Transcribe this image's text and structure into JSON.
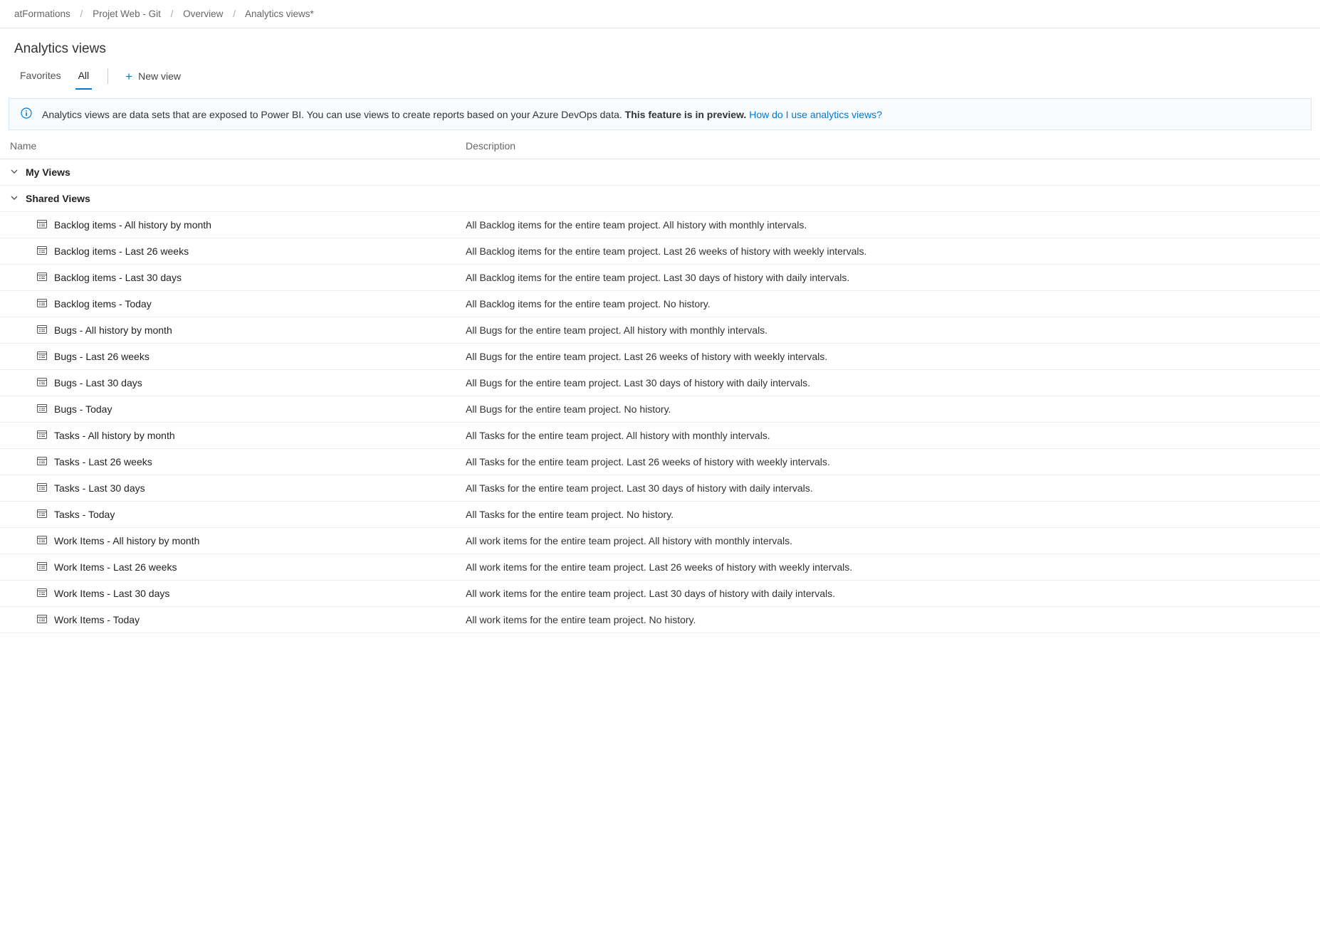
{
  "breadcrumbs": [
    {
      "label": "atFormations"
    },
    {
      "label": "Projet Web - Git"
    },
    {
      "label": "Overview"
    },
    {
      "label": "Analytics views*"
    }
  ],
  "page_title": "Analytics views",
  "tabs": {
    "favorites": "Favorites",
    "all": "All"
  },
  "new_view_label": "New view",
  "info_banner": {
    "text_pre": "Analytics views are data sets that are exposed to Power BI. You can use views to create reports based on your Azure DevOps data. ",
    "text_bold": "This feature is in preview.",
    "link_text": "How do I use analytics views?"
  },
  "table": {
    "header_name": "Name",
    "header_description": "Description"
  },
  "groups": {
    "my_views": "My Views",
    "shared_views": "Shared Views"
  },
  "shared_views_items": [
    {
      "name": "Backlog items - All history by month",
      "desc": "All Backlog items for the entire team project. All history with monthly intervals."
    },
    {
      "name": "Backlog items - Last 26 weeks",
      "desc": "All Backlog items for the entire team project. Last 26 weeks of history with weekly intervals."
    },
    {
      "name": "Backlog items - Last 30 days",
      "desc": "All Backlog items for the entire team project. Last 30 days of history with daily intervals."
    },
    {
      "name": "Backlog items - Today",
      "desc": "All Backlog items for the entire team project. No history."
    },
    {
      "name": "Bugs - All history by month",
      "desc": "All Bugs for the entire team project. All history with monthly intervals."
    },
    {
      "name": "Bugs - Last 26 weeks",
      "desc": "All Bugs for the entire team project. Last 26 weeks of history with weekly intervals."
    },
    {
      "name": "Bugs - Last 30 days",
      "desc": "All Bugs for the entire team project. Last 30 days of history with daily intervals."
    },
    {
      "name": "Bugs - Today",
      "desc": "All Bugs for the entire team project. No history."
    },
    {
      "name": "Tasks - All history by month",
      "desc": "All Tasks for the entire team project. All history with monthly intervals."
    },
    {
      "name": "Tasks - Last 26 weeks",
      "desc": "All Tasks for the entire team project. Last 26 weeks of history with weekly intervals."
    },
    {
      "name": "Tasks - Last 30 days",
      "desc": "All Tasks for the entire team project. Last 30 days of history with daily intervals."
    },
    {
      "name": "Tasks - Today",
      "desc": "All Tasks for the entire team project. No history."
    },
    {
      "name": "Work Items - All history by month",
      "desc": "All work items for the entire team project. All history with monthly intervals."
    },
    {
      "name": "Work Items - Last 26 weeks",
      "desc": "All work items for the entire team project. Last 26 weeks of history with weekly intervals."
    },
    {
      "name": "Work Items - Last 30 days",
      "desc": "All work items for the entire team project. Last 30 days of history with daily intervals."
    },
    {
      "name": "Work Items - Today",
      "desc": "All work items for the entire team project. No history."
    }
  ]
}
